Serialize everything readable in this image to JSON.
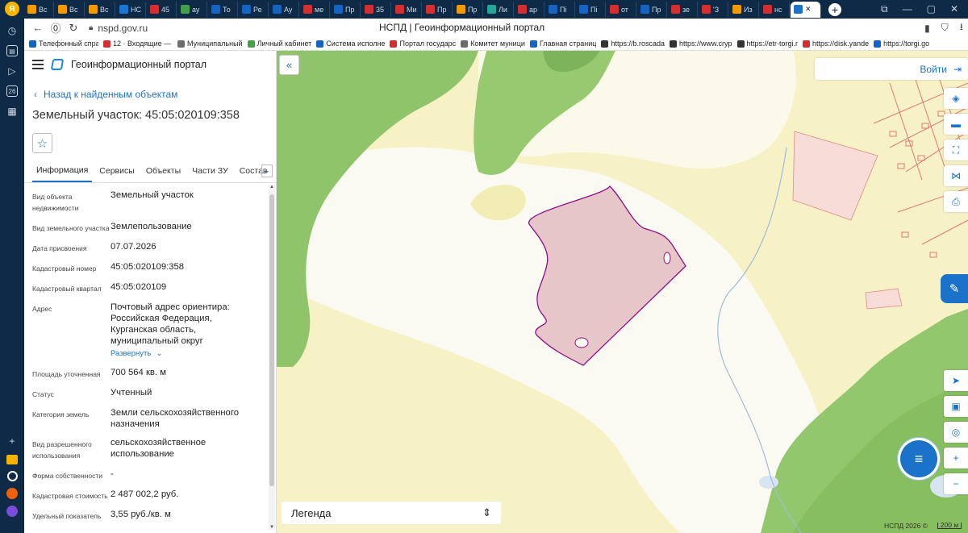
{
  "browser": {
    "tabs": [
      {
        "label": "Вс",
        "color": "#f29a00"
      },
      {
        "label": "Вс",
        "color": "#f29a00"
      },
      {
        "label": "Вс",
        "color": "#f29a00"
      },
      {
        "label": "НС",
        "color": "#1976d2"
      },
      {
        "label": "45",
        "color": "#d32f2f"
      },
      {
        "label": "ау",
        "color": "#43a047"
      },
      {
        "label": "То",
        "color": "#1565c0"
      },
      {
        "label": "Ре",
        "color": "#1565c0"
      },
      {
        "label": "Ау",
        "color": "#1565c0"
      },
      {
        "label": "ме",
        "color": "#d32f2f"
      },
      {
        "label": "Пр",
        "color": "#1565c0"
      },
      {
        "label": "35",
        "color": "#d32f2f"
      },
      {
        "label": "Ми",
        "color": "#d32f2f"
      },
      {
        "label": "Пр",
        "color": "#d32f2f"
      },
      {
        "label": "Пр",
        "color": "#f29a00"
      },
      {
        "label": "Ли",
        "color": "#26a69a"
      },
      {
        "label": "ар",
        "color": "#d32f2f"
      },
      {
        "label": "Пі",
        "color": "#1565c0"
      },
      {
        "label": "Пі",
        "color": "#1565c0"
      },
      {
        "label": "от",
        "color": "#d32f2f"
      },
      {
        "label": "Пр",
        "color": "#1565c0"
      },
      {
        "label": "зе",
        "color": "#d32f2f"
      },
      {
        "label": "'З",
        "color": "#d32f2f"
      },
      {
        "label": "Из",
        "color": "#f29a00"
      },
      {
        "label": "нс",
        "color": "#d32f2f"
      }
    ],
    "active_tab_close": "✕",
    "new_tab": "+",
    "url": "nspd.gov.ru",
    "page_title": "НСПД | Геоинформационный портал",
    "bookmarks": [
      {
        "label": "Телефонный спра",
        "color": "#1565c0"
      },
      {
        "label": "12 · Входящие — Я",
        "color": "#d32f2f"
      },
      {
        "label": "Муниципальный",
        "color": "#6d6d6d"
      },
      {
        "label": "Личный кабинет",
        "color": "#43a047"
      },
      {
        "label": "Система исполне",
        "color": "#1565c0"
      },
      {
        "label": "Портал государс",
        "color": "#d32f2f"
      },
      {
        "label": "Комитет муници",
        "color": "#6d6d6d"
      },
      {
        "label": "Главная страниц",
        "color": "#1565c0"
      },
      {
        "label": "https://b.roscada",
        "color": "#333333"
      },
      {
        "label": "https://www.cryp",
        "color": "#333333"
      },
      {
        "label": "https://etr-torgi.r",
        "color": "#333333"
      },
      {
        "label": "https://disk.yande",
        "color": "#d32f2f"
      },
      {
        "label": "https://torgi.go",
        "color": "#1565c0"
      }
    ]
  },
  "sidebar": {
    "portal_title": "Геоинформационный портал",
    "back_link": "Назад к найденным объектам",
    "object_title": "Земельный участок: 45:05:020109:358",
    "tabs": [
      "Информация",
      "Сервисы",
      "Объекты",
      "Части ЗУ",
      "Состав"
    ],
    "properties": [
      {
        "key": "Вид объекта недвижимости",
        "value": "Земельный участок"
      },
      {
        "key": "Вид земельного участка",
        "value": "Землепользование"
      },
      {
        "key": "Дата присвоения",
        "value": "07.07.2026"
      },
      {
        "key": "Кадастровый номер",
        "value": "45:05:020109:358"
      },
      {
        "key": "Кадастровый квартал",
        "value": "45:05:020109"
      },
      {
        "key": "Адрес",
        "value": "Почтовый адрес ориентира: Российская Федерация, Курганская область, муниципальный округ",
        "expand": "Развернуть"
      },
      {
        "key": "Площадь уточненная",
        "value": "700 564 кв. м"
      },
      {
        "key": "Статус",
        "value": "Учтенный"
      },
      {
        "key": "Категория земель",
        "value": "Земли сельскохозяйственного назначения"
      },
      {
        "key": "Вид разрешенного использования",
        "value": "сельскохозяйственное использование"
      },
      {
        "key": "Форма собственности",
        "value": "-"
      },
      {
        "key": "Кадастровая стоимость",
        "value": "2 487 002,2 руб."
      },
      {
        "key": "Удельный показатель",
        "value": "3,55 руб./кв. м"
      }
    ]
  },
  "map": {
    "login_label": "Войти",
    "legend_label": "Легенда",
    "credits": "НСПД 2026 ©",
    "scale": "200 м",
    "colors": {
      "parcel_fill": "#e7c6c9",
      "parcel_stroke": "#8e0e8a",
      "forest": "#8fc46a",
      "field": "#f7f1c6",
      "water": "#ffffff",
      "accent": "#1a73c8"
    }
  }
}
